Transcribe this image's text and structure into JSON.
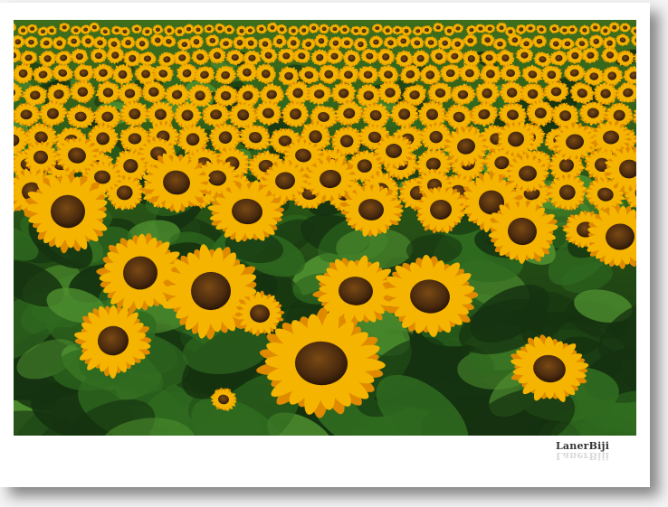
{
  "photo": {
    "subject": "sunflower-field",
    "colors": {
      "foliage_dark": "#153210",
      "foliage_mid": "#2f6a1f",
      "foliage_light": "#4f8f2f",
      "petal": "#f4b400",
      "petal_dark": "#e08a00",
      "disk": "#4a2a0e",
      "disk_light": "#7a4a14"
    }
  },
  "watermark": {
    "text": "LanerBiji"
  }
}
